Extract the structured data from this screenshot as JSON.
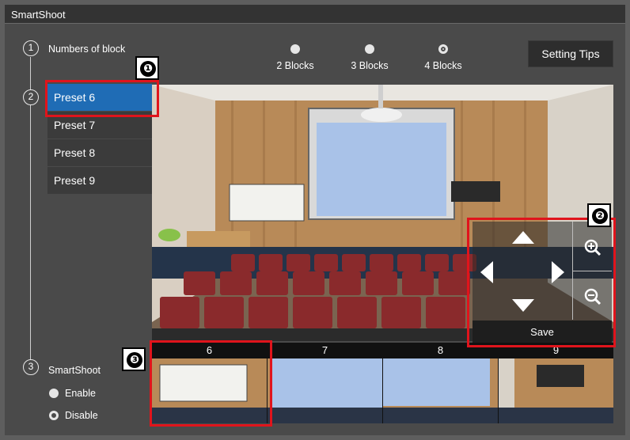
{
  "window": {
    "title": "SmartShoot"
  },
  "steps": [
    "1",
    "2",
    "3"
  ],
  "blocks": {
    "label": "Numbers of block",
    "options": [
      "2 Blocks",
      "3 Blocks",
      "4 Blocks"
    ],
    "selected": "4 Blocks"
  },
  "setting_tips_label": "Setting Tips",
  "presets": [
    "Preset 6",
    "Preset 7",
    "Preset 8",
    "Preset 9"
  ],
  "active_preset": "Preset 6",
  "ptz": {
    "save_label": "Save"
  },
  "thumbnails": [
    "6",
    "7",
    "8",
    "9"
  ],
  "smartshoot": {
    "label": "SmartShoot",
    "options": [
      "Enable",
      "Disable"
    ],
    "selected": "Disable"
  },
  "annotations": [
    "❶",
    "❷",
    "❸"
  ],
  "colors": {
    "highlight": "#e0141c",
    "active_preset": "#1f6cb5"
  }
}
